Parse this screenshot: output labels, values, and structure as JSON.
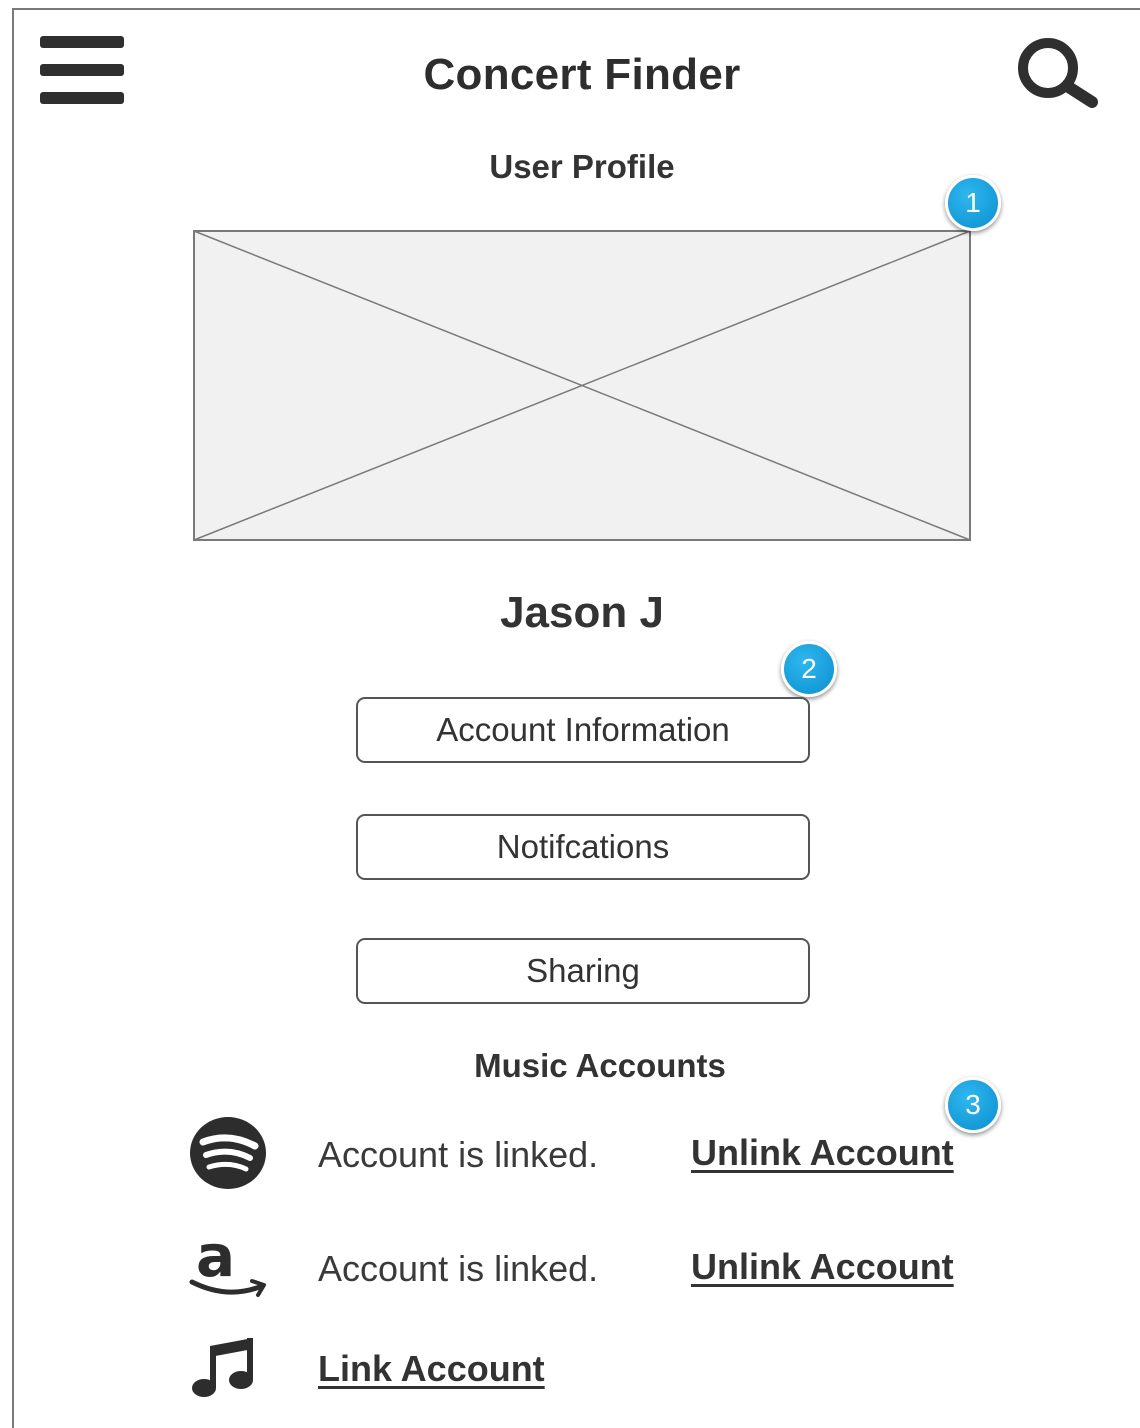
{
  "header": {
    "title": "Concert Finder",
    "menu_icon": "hamburger-menu-icon",
    "search_icon": "search-icon"
  },
  "profile": {
    "heading": "User Profile",
    "image_icon": "image-placeholder",
    "name": "Jason J"
  },
  "buttons": [
    {
      "label": "Account Information"
    },
    {
      "label": "Notifcations"
    },
    {
      "label": "Sharing"
    }
  ],
  "music": {
    "heading": "Music Accounts",
    "accounts": [
      {
        "icon": "spotify-icon",
        "status": "Account is linked.",
        "action": "Unlink Account"
      },
      {
        "icon": "amazon-icon",
        "status": "Account is linked.",
        "action": "Unlink Account"
      },
      {
        "icon": "music-note-icon",
        "status": "",
        "action": "Link Account"
      }
    ]
  },
  "annotations": [
    "1",
    "2",
    "3"
  ],
  "colors": {
    "badge": "#0a8fcd",
    "text": "#333333",
    "placeholder_fill": "#f1f1f1"
  }
}
